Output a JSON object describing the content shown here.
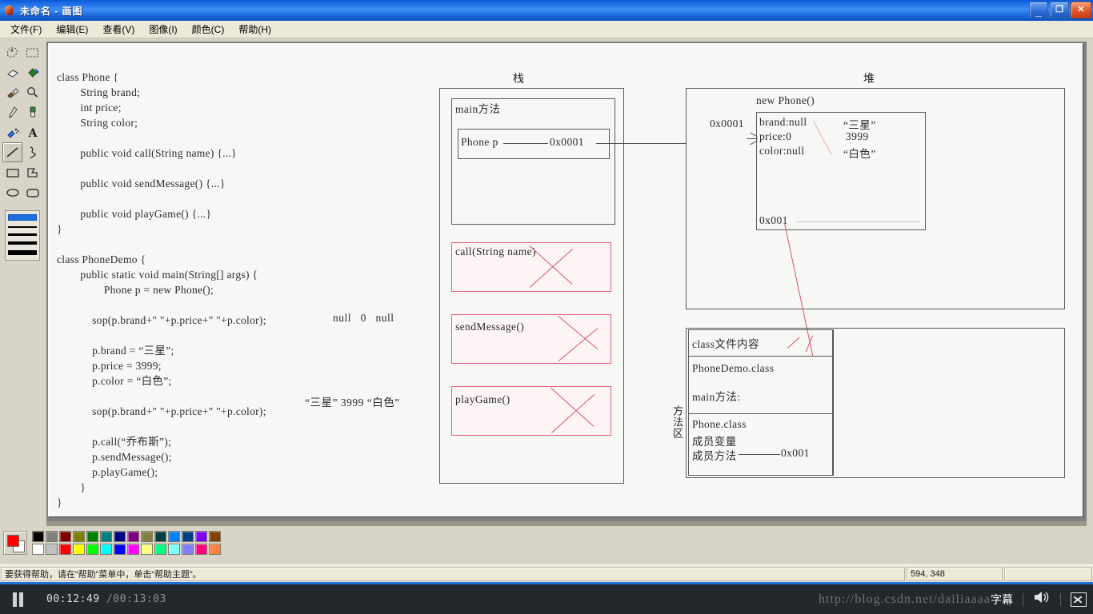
{
  "window": {
    "title": "未命名 - 画图",
    "app_icon": "paint-icon",
    "buttons": {
      "minimize": "_",
      "restore": "❐",
      "close": "✕"
    }
  },
  "menubar": {
    "items": [
      {
        "label": "文件(F)",
        "name": "menu-file"
      },
      {
        "label": "编辑(E)",
        "name": "menu-edit"
      },
      {
        "label": "查看(V)",
        "name": "menu-view"
      },
      {
        "label": "图像(I)",
        "name": "menu-image"
      },
      {
        "label": "颜色(C)",
        "name": "menu-color"
      },
      {
        "label": "帮助(H)",
        "name": "menu-help"
      }
    ]
  },
  "toolbox": {
    "tools": [
      "free-form-select-icon",
      "rectangle-select-icon",
      "eraser-icon",
      "fill-with-color-icon",
      "pick-color-icon",
      "magnifier-icon",
      "pencil-icon",
      "brush-icon",
      "airbrush-icon",
      "text-icon",
      "line-icon",
      "curve-icon",
      "rectangle-icon",
      "polygon-icon",
      "ellipse-icon",
      "rounded-rectangle-icon"
    ],
    "selected_tool": "line-icon",
    "line_widths": [
      8,
      2,
      3,
      4,
      5
    ],
    "selected_line_width_index": 0
  },
  "palette": {
    "foreground": "#ff0000",
    "background": "#ffffff",
    "row1": [
      "#000000",
      "#808080",
      "#800000",
      "#808000",
      "#008000",
      "#008080",
      "#000080",
      "#800080",
      "#808040",
      "#004040",
      "#0080ff",
      "#004080",
      "#8000ff",
      "#804000"
    ],
    "row2": [
      "#ffffff",
      "#c0c0c0",
      "#ff0000",
      "#ffff00",
      "#00ff00",
      "#00ffff",
      "#0000ff",
      "#ff00ff",
      "#ffff80",
      "#00ff80",
      "#80ffff",
      "#8080ff",
      "#ff0080",
      "#ff8040"
    ]
  },
  "statusbar": {
    "help_text": "要获得帮助，请在“帮助”菜单中，单击“帮助主题”。",
    "coordinates": "594, 348",
    "extra": ""
  },
  "player": {
    "state_icon": "pause-icon",
    "current_time": "00:12:49",
    "total_time": "/00:13:03",
    "watermark": "http://blog.csdn.net/dailiaaaa",
    "cc_label": "字幕",
    "volume_icon": "speaker-icon",
    "fullscreen_icon": "fullscreen-icon"
  },
  "drawing": {
    "code_lines": [
      "class Phone {",
      "        String brand;",
      "        int price;",
      "        String color;",
      "",
      "        public void call(String name) {...}",
      "",
      "        public void sendMessage() {...}",
      "",
      "        public void playGame() {...}",
      "}",
      "",
      "class PhoneDemo {",
      "        public static void main(String[] args) {",
      "                Phone p = new Phone();",
      "",
      "            sop(p.brand+\" \"+p.price+\" \"+p.color);",
      "",
      "            p.brand = “三星”;",
      "            p.price = 3999;",
      "            p.color = “白色”;",
      "",
      "            sop(p.brand+\" \"+p.price+\" \"+p.color);",
      "",
      "            p.call(“乔布斯”);",
      "            p.sendMessage();",
      "            p.playGame();",
      "        }",
      "}"
    ],
    "annotation_first_output": "null   0   null",
    "annotation_second_output": "“三星” 3999 “白色”",
    "stack": {
      "title": "栈",
      "frames": [
        {
          "label": "main方法",
          "var_name": "Phone p",
          "var_value": "0x0001"
        },
        {
          "label": "call(String name)",
          "crossed": true
        },
        {
          "label": "sendMessage()",
          "crossed": true
        },
        {
          "label": "playGame()",
          "crossed": true
        }
      ]
    },
    "heap": {
      "title": "堆",
      "object_label": "new Phone()",
      "address_pointer": "0x0001",
      "fields": [
        {
          "name": "brand:null",
          "new_value": "“三星”"
        },
        {
          "name": "price:0",
          "new_value": "3999"
        },
        {
          "name": "color:null",
          "new_value": "“白色”"
        }
      ],
      "method_ref": "0x001"
    },
    "method_area": {
      "vertical_label": "方法区",
      "header": "class文件内容",
      "rows": [
        "PhoneDemo.class",
        "main方法:",
        "Phone.class",
        "成员变量",
        "成员方法"
      ],
      "method_address": "0x001"
    }
  }
}
